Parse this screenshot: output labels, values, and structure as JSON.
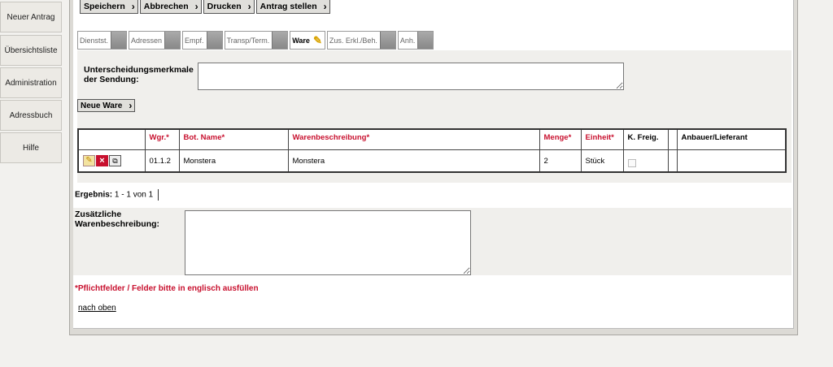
{
  "nav": {
    "items": [
      "Neuer Antrag",
      "Übersichtsliste",
      "Administration",
      "Adressbuch",
      "Hilfe"
    ]
  },
  "toolbar": {
    "save": "Speichern",
    "cancel": "Abbrechen",
    "print": "Drucken",
    "submit": "Antrag stellen"
  },
  "tabs": [
    "Dienstst.",
    "Adressen",
    "Empf.",
    "Transp/Term.",
    "Ware",
    "Zus. Erkl./Beh.",
    "Anh."
  ],
  "shipment": {
    "label": "Unterscheidungsmerkmale der Sendung:",
    "value": ""
  },
  "goods": {
    "new_button": "Neue Ware",
    "headers": {
      "wgr": "Wgr.*",
      "bot_name": "Bot. Name*",
      "description": "Warenbeschreibung*",
      "quantity": "Menge*",
      "unit": "Einheit*",
      "k_freig": "K. Freig.",
      "grower": "Anbauer/Lieferant"
    },
    "rows": [
      {
        "wgr": "01.1.2",
        "bot_name": "Monstera",
        "description": "Monstera",
        "quantity": "2",
        "unit": "Stück",
        "grower": ""
      }
    ]
  },
  "result": {
    "label": "Ergebnis:",
    "value": "1 - 1 von 1"
  },
  "additional": {
    "label": "Zusätzliche Warenbeschreibung:",
    "value": ""
  },
  "notice": "*Pflichtfelder / Felder bitte in englisch ausfüllen",
  "back_to_top": "nach oben",
  "colors": {
    "required": "#c8102e",
    "background": "#f2f1ee"
  }
}
